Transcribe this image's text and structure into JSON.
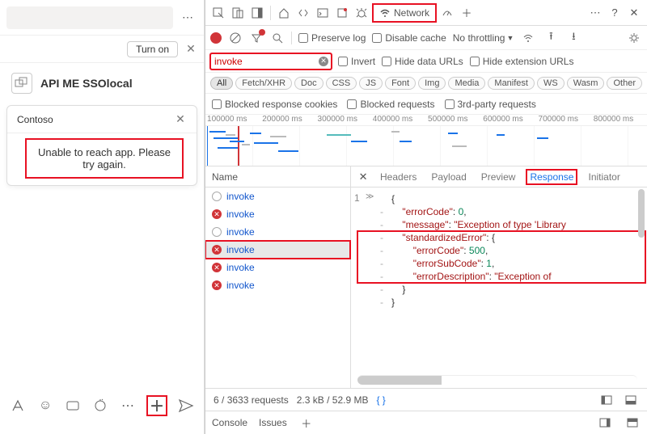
{
  "left": {
    "turn_on": "Turn on",
    "app_title": "API ME SSOlocal",
    "dialog_title": "Contoso",
    "dialog_message": "Unable to reach app. Please try again."
  },
  "devtools": {
    "tabs": {
      "network": "Network"
    },
    "row1": {
      "preserve_log": "Preserve log",
      "disable_cache": "Disable cache",
      "throttling": "No throttling"
    },
    "filter": {
      "value": "invoke",
      "invert": "Invert",
      "hide_data_urls": "Hide data URLs",
      "hide_ext_urls": "Hide extension URLs"
    },
    "type_filters": [
      "All",
      "Fetch/XHR",
      "Doc",
      "CSS",
      "JS",
      "Font",
      "Img",
      "Media",
      "Manifest",
      "WS",
      "Wasm",
      "Other"
    ],
    "row4": {
      "blocked_response_cookies": "Blocked response cookies",
      "blocked_requests": "Blocked requests",
      "third_party": "3rd-party requests"
    },
    "timeline_ticks": [
      "100000 ms",
      "200000 ms",
      "300000 ms",
      "400000 ms",
      "500000 ms",
      "600000 ms",
      "700000 ms",
      "800000 ms"
    ],
    "requests_header": "Name",
    "requests": [
      {
        "name": "invoke",
        "status": "none"
      },
      {
        "name": "invoke",
        "status": "error"
      },
      {
        "name": "invoke",
        "status": "none"
      },
      {
        "name": "invoke",
        "status": "error",
        "selected": true
      },
      {
        "name": "invoke",
        "status": "error"
      },
      {
        "name": "invoke",
        "status": "error"
      }
    ],
    "detail_tabs": [
      "Headers",
      "Payload",
      "Preview",
      "Response",
      "Initiator"
    ],
    "detail_active_tab": "Response",
    "response_json": {
      "line_no": "1",
      "open": "{",
      "errorCode_k": "\"errorCode\"",
      "errorCode_v": "0",
      "message_k": "\"message\"",
      "message_v": "\"Exception of type 'Library",
      "std_k": "\"standardizedError\"",
      "std_open": "{",
      "std_errorCode_k": "\"errorCode\"",
      "std_errorCode_v": "500",
      "std_errorSubCode_k": "\"errorSubCode\"",
      "std_errorSubCode_v": "1",
      "std_errorDescription_k": "\"errorDescription\"",
      "std_errorDescription_v": "\"Exception of",
      "close1": "}",
      "close2": "}"
    },
    "statusbar": {
      "requests": "6 / 3633 requests",
      "transfer": "2.3 kB / 52.9 MB",
      "braces": "{ }"
    },
    "bottom_tabs": {
      "console": "Console",
      "issues": "Issues"
    }
  }
}
